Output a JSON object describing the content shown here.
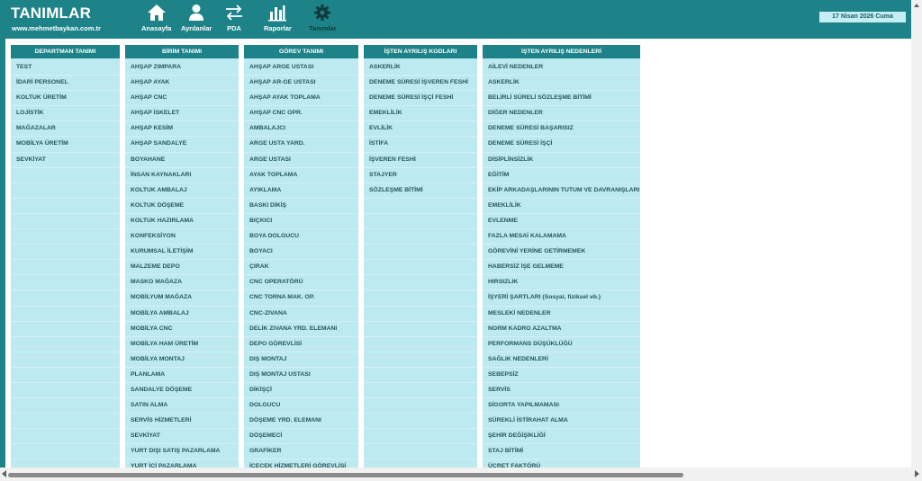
{
  "header": {
    "title": "TANIMLAR",
    "url": "www.mehmetbaykan.com.tr",
    "date": "17 Nisan 2026 Cuma",
    "nav": [
      {
        "label": "Anasayfa",
        "icon": "home-icon"
      },
      {
        "label": "Ayrılanlar",
        "icon": "user-icon"
      },
      {
        "label": "PDA",
        "icon": "transfer-arrows-icon"
      },
      {
        "label": "Raporlar",
        "icon": "bar-chart-icon"
      },
      {
        "label": "Tanımlar",
        "icon": "gear-icon"
      }
    ]
  },
  "columns": [
    {
      "title": "DEPARTMAN TANIMI",
      "items": [
        "TEST",
        "İDARİ PERSONEL",
        "KOLTUK ÜRETİM",
        "LOJİSTİK",
        "MAĞAZALAR",
        "MOBİLYA ÜRETİM",
        "SEVKİYAT"
      ]
    },
    {
      "title": "BİRİM TANIMI",
      "items": [
        "AHŞAP ZIMPARA",
        "AHŞAP AYAK",
        "AHŞAP CNC",
        "AHŞAP İSKELET",
        "AHŞAP KESİM",
        "AHŞAP SANDALYE",
        "BOYAHANE",
        "İNSAN KAYNAKLARI",
        "KOLTUK AMBALAJ",
        "KOLTUK DÖŞEME",
        "KOLTUK HAZIRLAMA",
        "KONFEKSİYON",
        "KURUMSAL İLETİŞİM",
        "MALZEME DEPO",
        "MASKO MAĞAZA",
        "MOBİLYUM MAĞAZA",
        "MOBİLYA AMBALAJ",
        "MOBİLYA CNC",
        "MOBİLYA HAM ÜRETİM",
        "MOBİLYA MONTAJ",
        "PLANLAMA",
        "SANDALYE DÖŞEME",
        "SATIN ALMA",
        "SERVİS HİZMETLERİ",
        "SEVKİYAT",
        "YURT DIŞI SATIŞ PAZARLAMA",
        "YURT İÇİ PAZARLAMA"
      ]
    },
    {
      "title": "GÖREV TANIMI",
      "items": [
        "AHŞAP ARGE USTASI",
        "AHŞAP AR-GE USTASI",
        "AHŞAP AYAK TOPLAMA",
        "AHŞAP CNC OPR.",
        "AMBALAJCI",
        "ARGE USTA YARD.",
        "ARGE USTASI",
        "AYAK TOPLAMA",
        "AYIKLAMA",
        "BASKI DİKİŞ",
        "BIÇKICI",
        "BOYA DOLGUCU",
        "BOYACI",
        "ÇIRAK",
        "CNC OPERATÖRÜ",
        "CNC TORNA MAK. OP.",
        "CNC-ZIVANA",
        "DELİK ZIVANA YRD. ELEMANI",
        "DEPO GÖREVLİSİ",
        "DIŞ MONTAJ",
        "DIŞ MONTAJ USTASI",
        "DİKİŞÇİ",
        "DOLGUCU",
        "DÖŞEME YRD. ELEMANI",
        "DÖŞEMECİ",
        "GRAFİKER",
        "İÇECEK HİZMETLERİ GÖREVLİSİ"
      ]
    },
    {
      "title": "İŞTEN AYRILIŞ KODLARI",
      "items": [
        "ASKERLİK",
        "DENEME SÜRESİ İŞVEREN FESHİ",
        "DENEME SÜRESİ İŞÇİ FESHİ",
        "EMEKLİLİK",
        "EVLİLİK",
        "İSTİFA",
        "İŞVEREN FESHİ",
        "STAJYER",
        "SÖZLEŞME BİTİMİ"
      ]
    },
    {
      "title": "İŞTEN AYRILIŞ NEDENLERİ",
      "items": [
        "AİLEVİ NEDENLER",
        "ASKERLİK",
        "BELİRLİ SÜRELİ SÖZLEŞME BİTİMİ",
        "DİĞER NEDENLER",
        "DENEME SÜRESİ BAŞARISIZ",
        "DENEME SÜRESİ İŞÇİ",
        "DİSİPLİNSİZLİK",
        "EĞİTİM",
        "EKİP ARKADAŞLARININ TUTUM VE DAVRANIŞLARI",
        "EMEKLİLİK",
        "EVLENME",
        "FAZLA MESAİ KALAMAMA",
        "GÖREVİNİ YERİNE GETİRMEMEK",
        "HABERSİZ İŞE GELMEME",
        "HIRSIZLIK",
        "İŞYERİ ŞARTLARI (Sosyal, fiziksel vb.)",
        "MESLEKİ NEDENLER",
        "NORM KADRO AZALTMA",
        "PERFORMANS DÜŞÜKLÜĞÜ",
        "SAĞLIK NEDENLERİ",
        "SEBEPSİZ",
        "SERVİS",
        "SİGORTA YAPILMAMASI",
        "SÜREKLİ İSTİRAHAT ALMA",
        "ŞEHİR DEĞİŞİKLİĞİ",
        "STAJ BİTİMİ",
        "ÜCRET FAKTÖRÜ"
      ]
    }
  ]
}
